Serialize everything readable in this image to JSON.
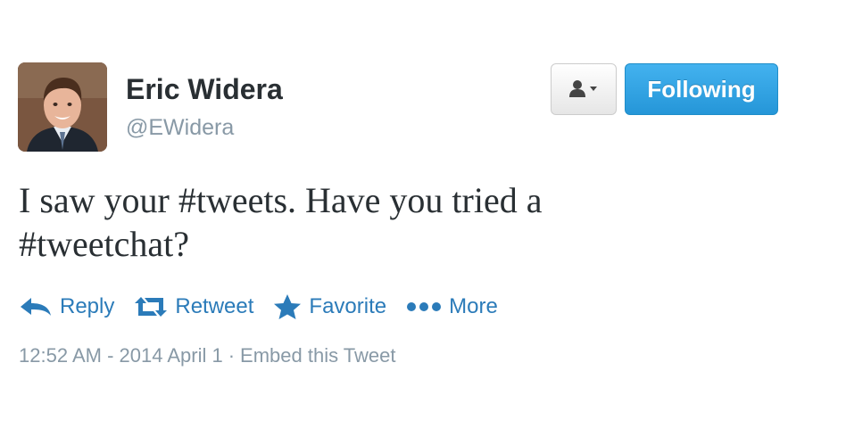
{
  "user": {
    "display_name": "Eric Widera",
    "screen_name": "@EWidera",
    "avatar_icon": "user-avatar-photo"
  },
  "header_buttons": {
    "user_actions_icon": "person-dropdown-icon",
    "follow_label": "Following"
  },
  "tweet": {
    "text_line1": "I saw your #tweets. Have you tried a",
    "text_line2": "#tweetchat?"
  },
  "actions": [
    {
      "label": "Reply",
      "icon": "reply-icon"
    },
    {
      "label": "Retweet",
      "icon": "retweet-icon"
    },
    {
      "label": "Favorite",
      "icon": "star-icon"
    },
    {
      "label": "More",
      "icon": "more-dots-icon"
    }
  ],
  "meta": {
    "timestamp": "12:52 AM - 2014 April 1",
    "separator": "·",
    "embed_label": "Embed this Tweet"
  },
  "colors": {
    "link": "#2b7bb9",
    "follow_button": "#2596d8",
    "muted": "#8899a6",
    "text": "#292f33"
  }
}
